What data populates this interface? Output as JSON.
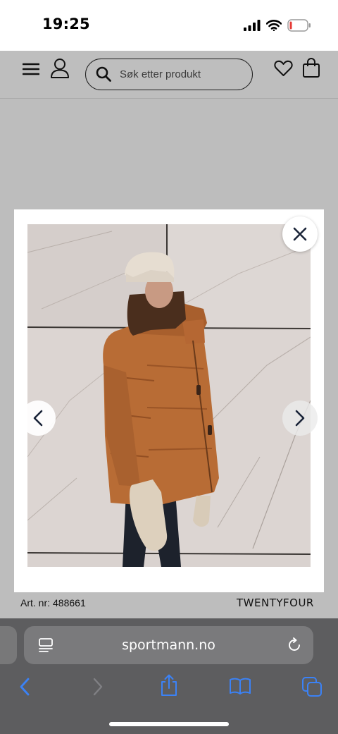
{
  "status_bar": {
    "time": "19:25",
    "icons": [
      "signal-icon",
      "wifi-icon",
      "battery-low-icon"
    ]
  },
  "header": {
    "search": {
      "placeholder": "Søk etter produkt"
    },
    "icons": [
      "menu-icon",
      "user-icon",
      "search-icon",
      "heart-icon",
      "shopping-bag-icon"
    ]
  },
  "gallery": {
    "icons": [
      "close-icon",
      "chevron-left-icon",
      "chevron-right-icon"
    ]
  },
  "product": {
    "art_label": "Art. nr:",
    "art_number": "488661",
    "brand": "TWENTYFOUR"
  },
  "browser": {
    "url": "sportmann.no",
    "icons": [
      "reader-mode-icon",
      "reload-icon",
      "back-icon",
      "forward-icon",
      "share-icon",
      "bookmarks-icon",
      "tabs-icon"
    ],
    "accent": "#3b82f6"
  }
}
